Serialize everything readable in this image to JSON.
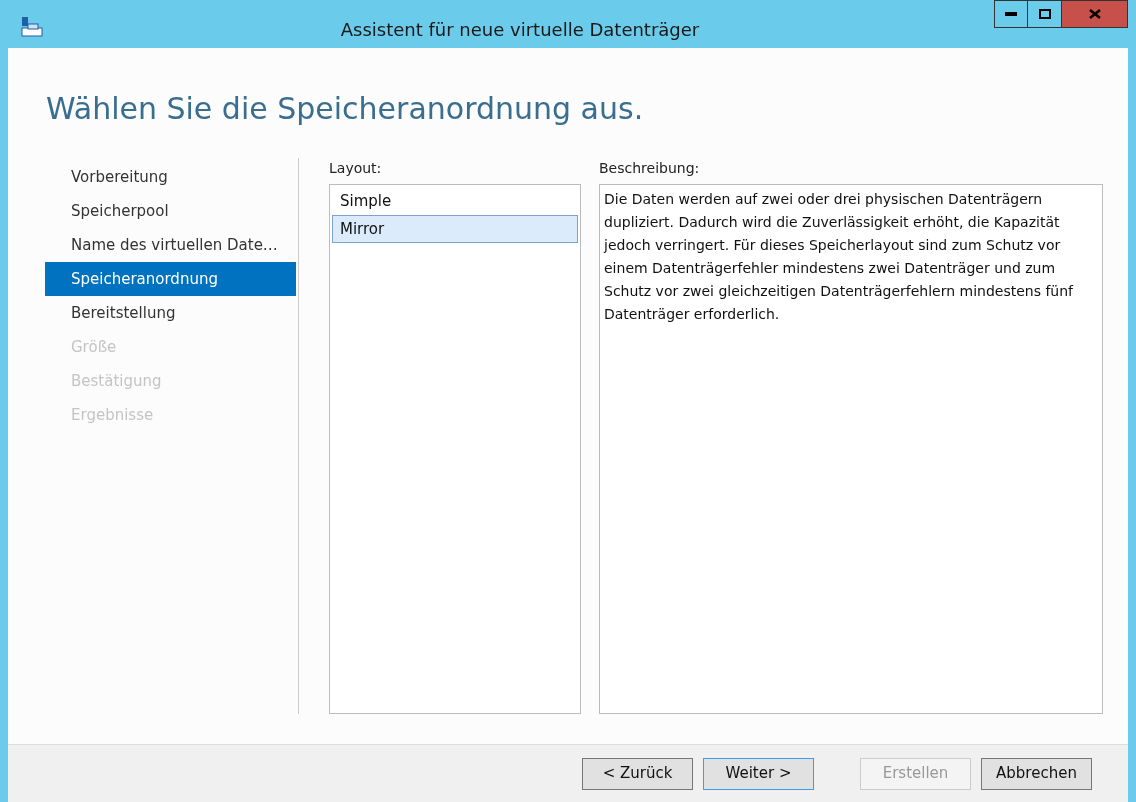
{
  "window": {
    "title": "Assistent für neue virtuelle Datenträger"
  },
  "heading": "Wählen Sie die Speicheranordnung aus.",
  "steps": [
    {
      "label": "Vorbereitung",
      "selected": false,
      "disabled": false
    },
    {
      "label": "Speicherpool",
      "selected": false,
      "disabled": false
    },
    {
      "label": "Name des virtuellen Date…",
      "selected": false,
      "disabled": false
    },
    {
      "label": "Speicheranordnung",
      "selected": true,
      "disabled": false
    },
    {
      "label": "Bereitstellung",
      "selected": false,
      "disabled": false
    },
    {
      "label": "Größe",
      "selected": false,
      "disabled": true
    },
    {
      "label": "Bestätigung",
      "selected": false,
      "disabled": true
    },
    {
      "label": "Ergebnisse",
      "selected": false,
      "disabled": true
    }
  ],
  "layout": {
    "label": "Layout:",
    "items": [
      {
        "label": "Simple",
        "selected": false
      },
      {
        "label": "Mirror",
        "selected": true
      }
    ]
  },
  "description": {
    "label": "Beschreibung:",
    "text": "Die Daten werden auf zwei oder drei physischen Datenträgern dupliziert. Dadurch wird die Zuverlässigkeit erhöht, die Kapazität jedoch verringert. Für dieses Speicherlayout sind zum Schutz vor einem Datenträgerfehler mindestens zwei Datenträger und zum Schutz vor zwei gleichzeitigen Datenträgerfehlern mindestens fünf Datenträger erforderlich."
  },
  "buttons": [
    {
      "label": "< Zurück",
      "default": false,
      "disabled": false
    },
    {
      "label": "Weiter >",
      "default": true,
      "disabled": false
    },
    {
      "label": "Erstellen",
      "default": false,
      "disabled": true
    },
    {
      "label": "Abbrechen",
      "default": false,
      "disabled": false
    }
  ]
}
